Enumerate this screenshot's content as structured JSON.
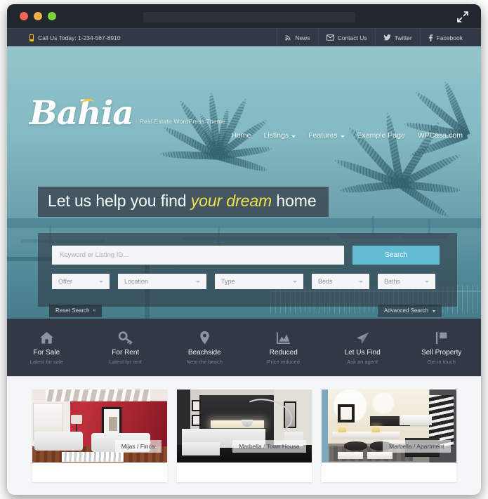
{
  "browser": {
    "lights": [
      "close",
      "minimize",
      "maximize"
    ],
    "url_value": "",
    "expand_icon": "expand-arrows-icon"
  },
  "topbar": {
    "phone_icon": "mobile-phone-icon",
    "phone_text": "Call Us Today: 1-234-567-8910",
    "social": [
      {
        "label": "News",
        "icon": "rss-icon"
      },
      {
        "label": "Contact Us",
        "icon": "envelope-icon"
      },
      {
        "label": "Twitter",
        "icon": "twitter-bird-icon"
      },
      {
        "label": "Facebook",
        "icon": "facebook-f-icon"
      }
    ]
  },
  "header": {
    "logo": "Bahia",
    "tagline": "Real Estate WordPress Theme",
    "nav": [
      {
        "label": "Home",
        "has_dropdown": false
      },
      {
        "label": "Listings",
        "has_dropdown": true
      },
      {
        "label": "Features",
        "has_dropdown": true
      },
      {
        "label": "Example Page",
        "has_dropdown": false
      },
      {
        "label": "WPCasa.com",
        "has_dropdown": false
      }
    ]
  },
  "hero": {
    "headline_pre": "Let us help you find ",
    "headline_em": "your dream",
    "headline_post": " home"
  },
  "search": {
    "keyword_placeholder": "Keyword or Listing ID...",
    "keyword_value": "",
    "search_button": "Search",
    "filters": [
      {
        "label": "Offer"
      },
      {
        "label": "Location"
      },
      {
        "label": "Type"
      },
      {
        "label": "Beds"
      },
      {
        "label": "Baths"
      }
    ],
    "reset_label": "Reset Search",
    "advanced_label": "Advanced Search"
  },
  "services": [
    {
      "title": "For Sale",
      "sub": "Latest for sale",
      "icon": "house-icon"
    },
    {
      "title": "For Rent",
      "sub": "Latest for rent",
      "icon": "key-icon"
    },
    {
      "title": "Beachside",
      "sub": "Near the beach",
      "icon": "map-pin-icon"
    },
    {
      "title": "Reduced",
      "sub": "Price reduced",
      "icon": "chart-icon"
    },
    {
      "title": "Let Us Find",
      "sub": "Ask an agent",
      "icon": "paper-plane-icon"
    },
    {
      "title": "Sell Property",
      "sub": "Get in touch",
      "icon": "flag-icon"
    }
  ],
  "listings": [
    {
      "label": "Mijas / Finca"
    },
    {
      "label": "Marbella / Town House"
    },
    {
      "label": "Marbella / Apartment"
    }
  ],
  "colors": {
    "chrome": "#22272e",
    "topbar": "#323944",
    "accent_yellow": "#f2e14a",
    "search_button": "#62bcd4",
    "hero_sky": "#8fc3cb",
    "listings_bg": "#f4f6f8"
  }
}
